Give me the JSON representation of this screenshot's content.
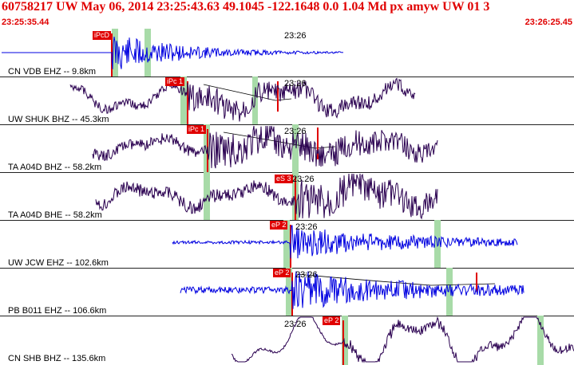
{
  "header": {
    "title": "60758217 UW May 06, 2014 23:25:43.63    49.1045 -122.1648  0.0 1.04 Md px amyw UW 01    3",
    "start_time": "23:25:35.44",
    "end_time": "23:26:25.45"
  },
  "panels": [
    {
      "label": "CN VDB EHZ -- 9.8km",
      "tick": "23:26",
      "pick": "iPcD",
      "color": "#0000e0"
    },
    {
      "label": "UW SHUK BHZ -- 45.3km",
      "tick": "23:26",
      "pick": "iPc 1",
      "color": "#2a0050"
    },
    {
      "label": "TA A04D BHZ -- 58.2km",
      "tick": "23:26",
      "pick": "iPc 1",
      "color": "#2a0050"
    },
    {
      "label": "TA A04D BHE -- 58.2km",
      "tick": "23:26",
      "pick": "eS 3",
      "color": "#2a0050"
    },
    {
      "label": "UW JCW EHZ -- 102.6km",
      "tick": "23:26",
      "pick": "eP 2",
      "color": "#0000e0"
    },
    {
      "label": "PB B011 EHZ -- 106.6km",
      "tick": "23:26",
      "pick": "eP 2",
      "color": "#0000e0"
    },
    {
      "label": "CN SHB BHZ -- 135.6km",
      "tick": "23:26",
      "pick": "eP 2",
      "color": "#2a0050"
    }
  ],
  "colors": {
    "title": "#e00000",
    "pick_flag": "#e00000",
    "window_band": "#a8dba8",
    "high_freq_trace": "#0000e0",
    "broadband_trace": "#2a0050"
  }
}
